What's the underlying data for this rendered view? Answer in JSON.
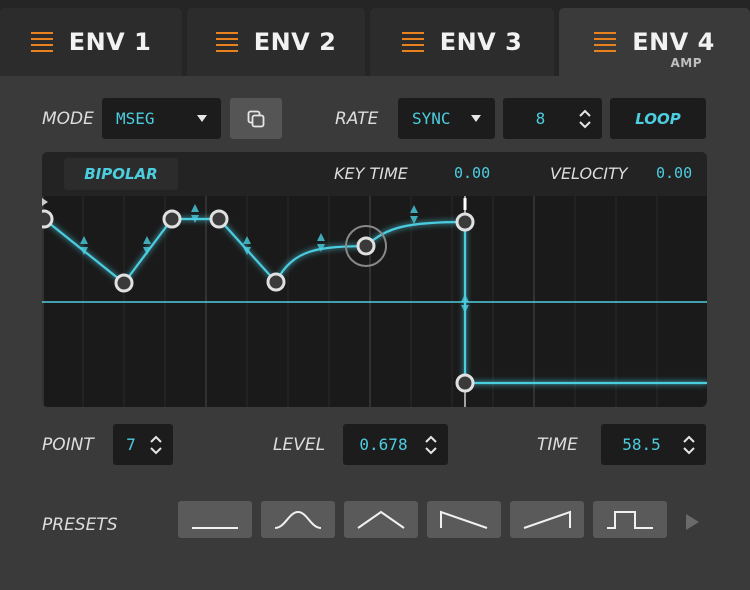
{
  "tabs": [
    {
      "label": "ENV 1",
      "sub": ""
    },
    {
      "label": "ENV 2",
      "sub": ""
    },
    {
      "label": "ENV 3",
      "sub": ""
    },
    {
      "label": "ENV 4",
      "sub": "AMP"
    }
  ],
  "mode": {
    "label": "MODE",
    "value": "MSEG"
  },
  "rate": {
    "label": "RATE",
    "value": "SYNC",
    "division": "8",
    "loop_label": "LOOP"
  },
  "editor": {
    "bipolar_label": "BIPOLAR",
    "key_time_label": "KEY TIME",
    "key_time_value": "0.00",
    "velocity_label": "VELOCITY",
    "velocity_value": "0.00"
  },
  "point": {
    "label": "POINT",
    "value": "7"
  },
  "level": {
    "label": "LEVEL",
    "value": "0.678"
  },
  "time": {
    "label": "TIME",
    "value": "58.5"
  },
  "presets": {
    "label": "PRESETS",
    "shapes": [
      "flat-icon",
      "bell-icon",
      "triangle-icon",
      "ramp-down-icon",
      "ramp-up-icon",
      "square-icon"
    ]
  },
  "colors": {
    "accent": "#4ccde0",
    "tab_icon": "#e8821e"
  }
}
